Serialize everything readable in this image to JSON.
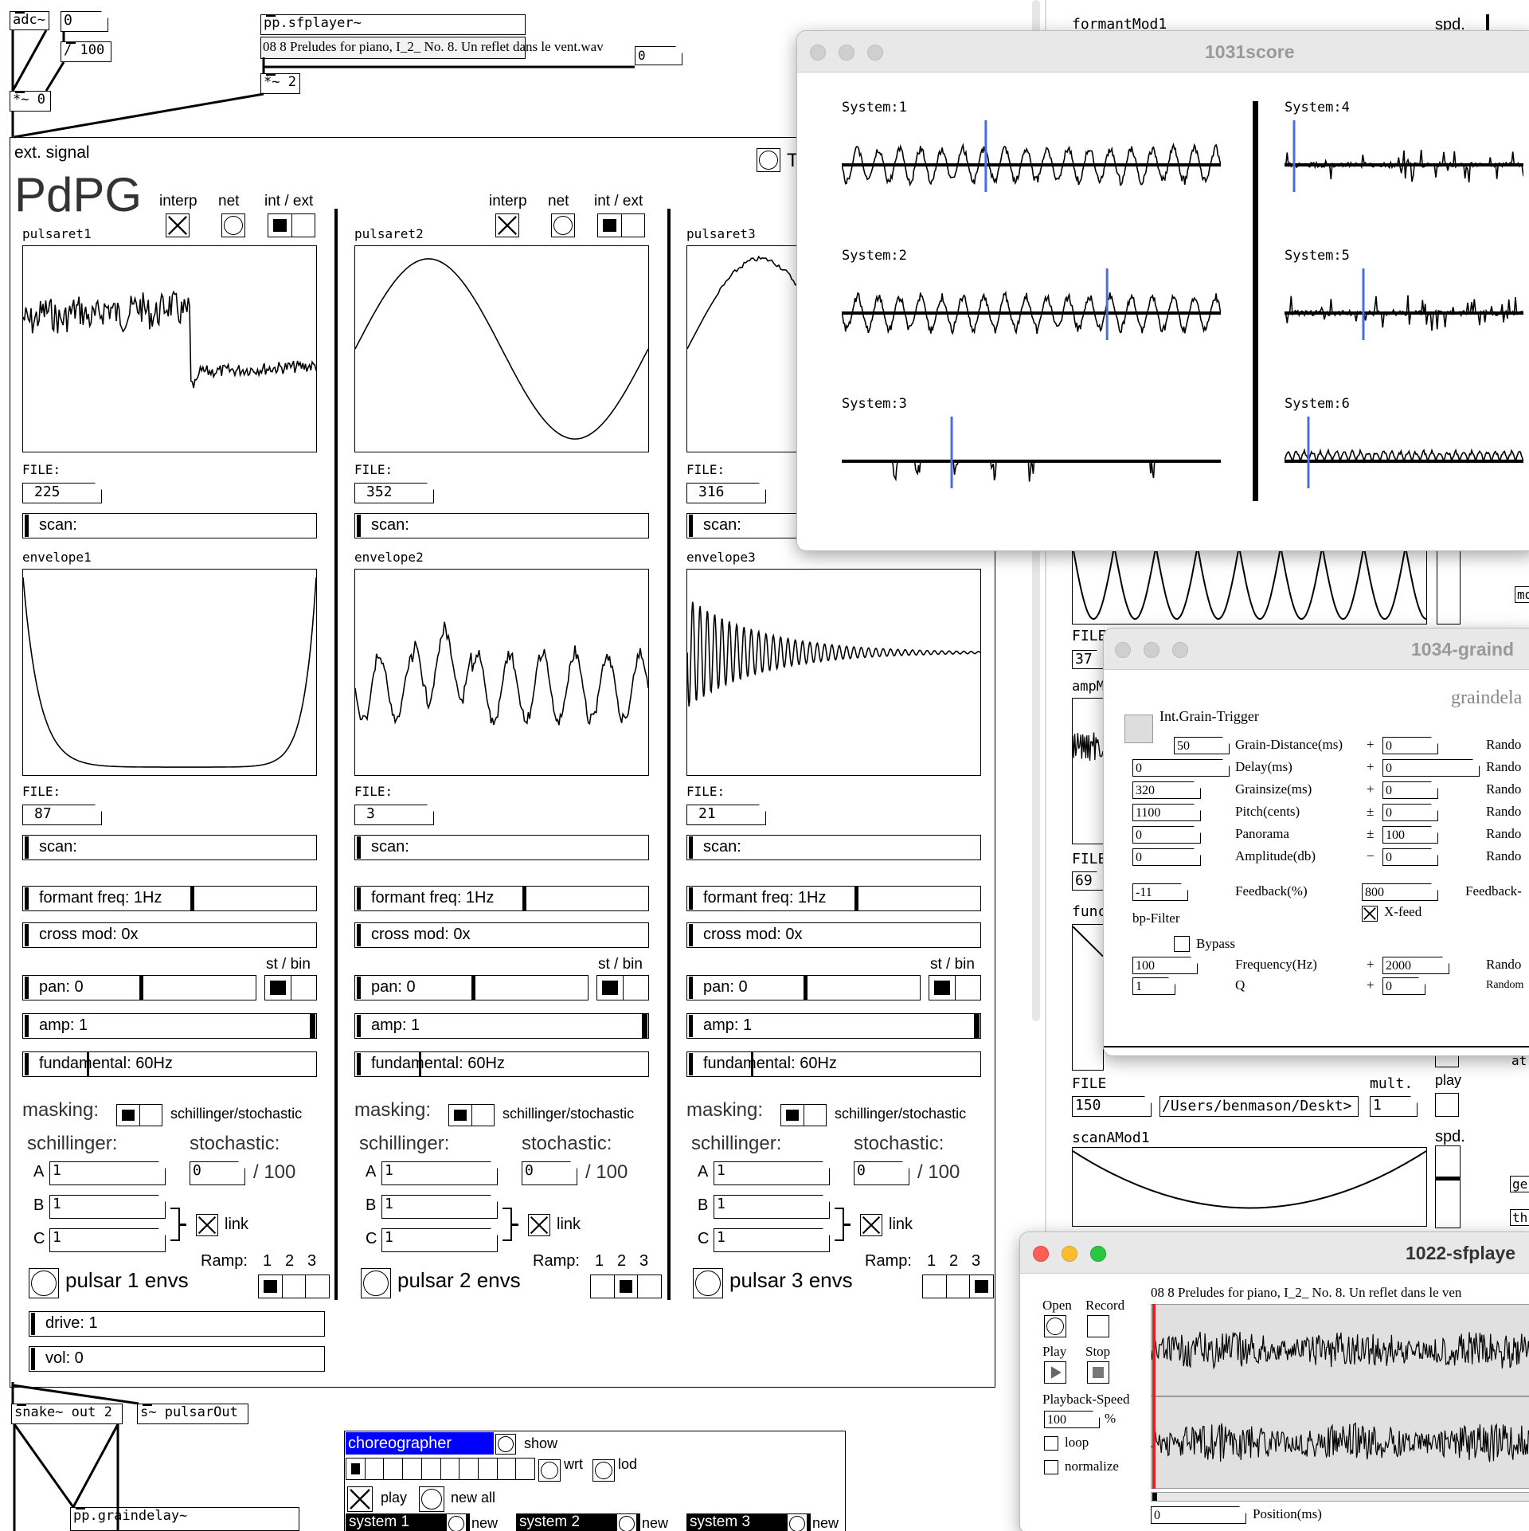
{
  "top": {
    "adc": "adc~",
    "num0": "0",
    "div100": "/ 100",
    "mul0": "*~ 0",
    "sfplayer": "pp.sfplayer~",
    "sfplayer_file": "08 8 Preludes for piano, I_2_ No. 8. Un reflet dans le vent.wav",
    "sf_num": "0",
    "mul2": "*~ 2"
  },
  "main": {
    "ext_signal": "ext. signal",
    "title": "PdPG",
    "top_right_label": "T",
    "columns": [
      {
        "interp": "interp",
        "net": "net",
        "intext": "int / ext",
        "pulsaret": "pulsaret1",
        "file_label": "FILE:",
        "pfile": "225",
        "scan": "scan:",
        "envelope": "envelope1",
        "efile": "87",
        "escan": "scan:",
        "formant": "formant freq: 1Hz",
        "cross": "cross mod: 0x",
        "stbin": "st / bin",
        "pan": "pan: 0",
        "amp": "amp: 1",
        "fund": "fundamental: 60Hz",
        "masking": "masking:",
        "mask_type": "schillinger/stochastic",
        "schillinger": "schillinger:",
        "stochastic": "stochastic:",
        "A": "A",
        "B": "B",
        "C": "C",
        "a_val": "1",
        "b_val": "1",
        "c_val": "1",
        "stoch_val": "0",
        "stoch_div": "/ 100",
        "link": "link",
        "ramp": "Ramp:",
        "r1": "1",
        "r2": "2",
        "r3": "3",
        "envs": "pulsar 1 envs"
      },
      {
        "interp": "interp",
        "net": "net",
        "intext": "int / ext",
        "pulsaret": "pulsaret2",
        "file_label": "FILE:",
        "pfile": "352",
        "scan": "scan:",
        "envelope": "envelope2",
        "efile": "3",
        "escan": "scan:",
        "formant": "formant freq: 1Hz",
        "cross": "cross mod: 0x",
        "stbin": "st / bin",
        "pan": "pan: 0",
        "amp": "amp: 1",
        "fund": "fundamental: 60Hz",
        "masking": "masking:",
        "mask_type": "schillinger/stochastic",
        "schillinger": "schillinger:",
        "stochastic": "stochastic:",
        "A": "A",
        "B": "B",
        "C": "C",
        "a_val": "1",
        "b_val": "1",
        "c_val": "1",
        "stoch_val": "0",
        "stoch_div": "/ 100",
        "link": "link",
        "ramp": "Ramp:",
        "r1": "1",
        "r2": "2",
        "r3": "3",
        "envs": "pulsar 2 envs"
      },
      {
        "interp": "",
        "net": "",
        "intext": "",
        "pulsaret": "pulsaret3",
        "file_label": "FILE:",
        "pfile": "316",
        "scan": "scan:",
        "envelope": "envelope3",
        "efile": "21",
        "escan": "scan:",
        "formant": "formant freq: 1Hz",
        "cross": "cross mod: 0x",
        "stbin": "st / bin",
        "pan": "pan: 0",
        "amp": "amp: 1",
        "fund": "fundamental: 60Hz",
        "masking": "masking:",
        "mask_type": "schillinger/stochastic",
        "schillinger": "schillinger:",
        "stochastic": "stochastic:",
        "A": "A",
        "B": "B",
        "C": "C",
        "a_val": "1",
        "b_val": "1",
        "c_val": "1",
        "stoch_val": "0",
        "stoch_div": "/ 100",
        "link": "link",
        "ramp": "Ramp:",
        "r1": "1",
        "r2": "2",
        "r3": "3",
        "envs": "pulsar 3 envs"
      }
    ],
    "drive": "drive: 1",
    "vol": "vol: 0"
  },
  "bottom": {
    "snake": "snake~ out 2",
    "send": "s~ pulsarOut",
    "graindelay": "pp.graindelay~",
    "choreographer": "choreographer",
    "show": "show",
    "wrt": "wrt",
    "lod": "lod",
    "play": "play",
    "new_all": "new all",
    "system1": "system 1",
    "system2": "system 2",
    "system3": "system 3",
    "new": "new",
    "accent": "#0000ff"
  },
  "right_bg": {
    "formantMod": "formantMod1",
    "spd": "spd.",
    "file1": "FILE",
    "file1_val": "37",
    "ampm": "ampM",
    "file2": "FILE",
    "file2_val": "69",
    "func": "func",
    "file3": "FILE",
    "file3_val": "150",
    "path": "/Users/benmason/Deskt>",
    "mult": "mult.",
    "mult_val": "1",
    "play": "play",
    "scan_mod": "scanAMod1",
    "spd2": "spd.",
    "mo": "mo",
    "at": "at",
    "ge": "ge",
    "th": "th"
  },
  "score_window": {
    "title": "1031score",
    "systems": [
      "System:1",
      "System:2",
      "System:3",
      "System:4",
      "System:5",
      "System:6"
    ],
    "playhead_color": "#4a6ee0"
  },
  "grain_window": {
    "title": "1034-graind",
    "heading": "graindela",
    "trigger": "Int.Grain-Trigger",
    "rows": [
      {
        "left": "50",
        "label": "Grain-Distance(ms)",
        "op": "+",
        "right": "0",
        "rnd": "Rando"
      },
      {
        "left": "0",
        "label": "Delay(ms)",
        "op": "+",
        "right": "0",
        "rnd": "Rando"
      },
      {
        "left": "320",
        "label": "Grainsize(ms)",
        "op": "+",
        "right": "0",
        "rnd": "Rando"
      },
      {
        "left": "1100",
        "label": "Pitch(cents)",
        "op": "±",
        "right": "0",
        "rnd": "Rando"
      },
      {
        "left": "0",
        "label": "Panorama",
        "op": "±",
        "right": "100",
        "rnd": "Rando"
      },
      {
        "left": "0",
        "label": "Amplitude(db)",
        "op": "−",
        "right": "0",
        "rnd": "Rando"
      }
    ],
    "fb_left": "-11",
    "fb_label": "Feedback(%)",
    "fb_right": "800",
    "fb_rnd": "Feedback-",
    "xfeed": "X-feed",
    "bpfilter": "bp-Filter",
    "bypass": "Bypass",
    "freq_left": "100",
    "freq_label": "Frequency(Hz)",
    "freq_op": "+",
    "freq_right": "2000",
    "freq_rnd": "Rando",
    "q_left": "1",
    "q_label": "Q",
    "q_op": "+",
    "q_right": "0",
    "q_rnd": "Random"
  },
  "sf_window": {
    "title": "1022-sfplaye",
    "open": "Open",
    "record": "Record",
    "play": "Play",
    "stop": "Stop",
    "speed_label": "Playback-Speed",
    "speed": "100",
    "pct": "%",
    "loop": "loop",
    "normalize": "normalize",
    "filename": "08 8 Preludes for piano, I_2_ No. 8. Un reflet dans le ven",
    "position": "0",
    "position_label": "Position(ms)",
    "close_color": "#ff5f57",
    "min_color": "#febc2e",
    "max_color": "#28c840"
  }
}
